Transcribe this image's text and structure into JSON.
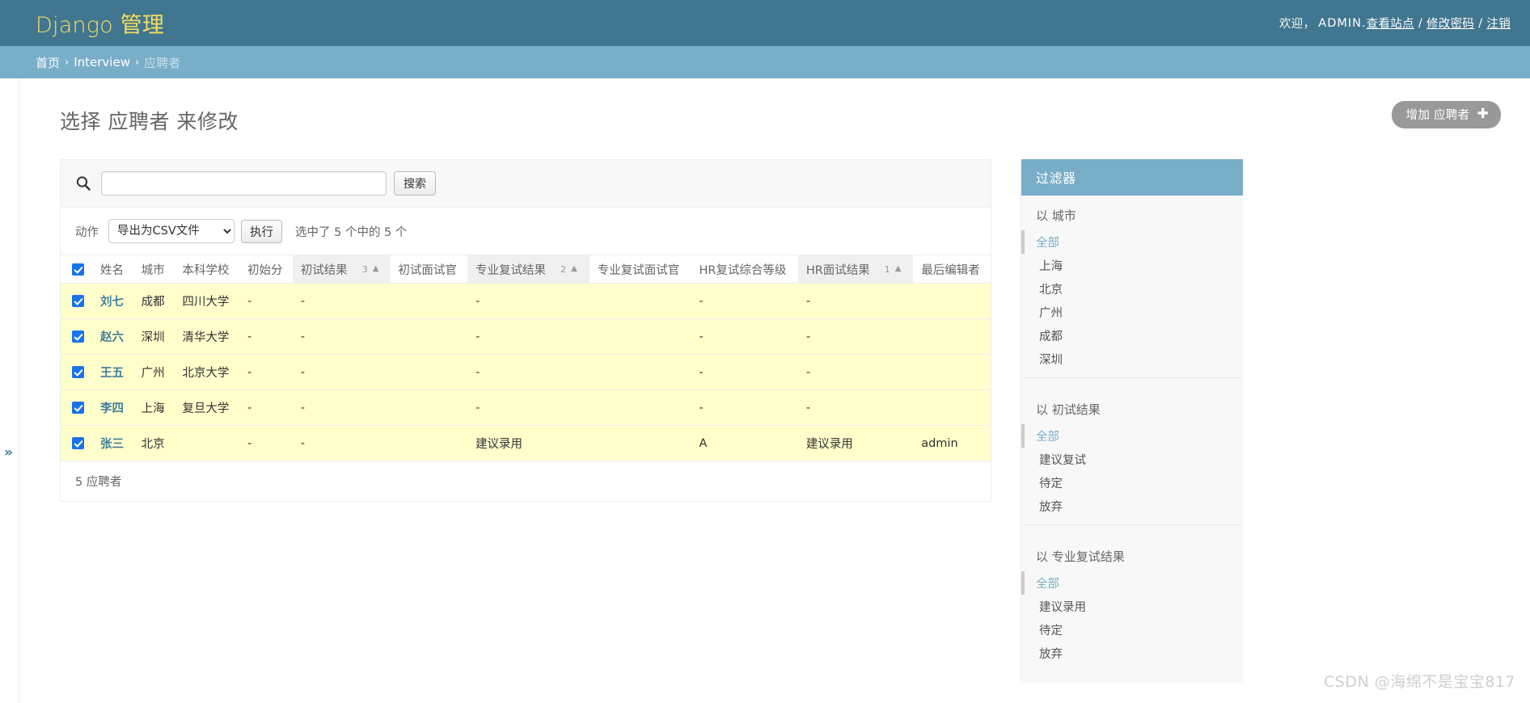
{
  "header": {
    "branding_title": "Django 管理",
    "welcome": "欢迎，",
    "username": "ADMIN.",
    "links": [
      {
        "label": "查看站点"
      },
      {
        "label": "修改密码"
      },
      {
        "label": "注销"
      }
    ],
    "separator": "/"
  },
  "breadcrumbs": {
    "items": [
      {
        "label": "首页",
        "current": false
      },
      {
        "label": "Interview",
        "current": false
      },
      {
        "label": "应聘者",
        "current": true
      }
    ],
    "separator": "›"
  },
  "page": {
    "title": "选择 应聘者 来修改",
    "add_button_label": "增加 应聘者",
    "add_button_icon": "plus-icon"
  },
  "search": {
    "icon": "search-icon",
    "value": "",
    "placeholder": "",
    "submit_label": "搜索"
  },
  "actions": {
    "label": "动作",
    "selected_action": "导出为CSV文件",
    "options": [
      "导出为CSV文件"
    ],
    "go_label": "执行",
    "counter": "选中了 5 个中的 5 个"
  },
  "table": {
    "select_all_checked": true,
    "columns": [
      {
        "label": "",
        "key": "checkbox",
        "sorted": false,
        "sort_priority": "",
        "sort_arrow": ""
      },
      {
        "label": "姓名",
        "key": "name",
        "sorted": false,
        "sort_priority": "",
        "sort_arrow": ""
      },
      {
        "label": "城市",
        "key": "city",
        "sorted": false,
        "sort_priority": "",
        "sort_arrow": ""
      },
      {
        "label": "本科学校",
        "key": "school",
        "sorted": false,
        "sort_priority": "",
        "sort_arrow": ""
      },
      {
        "label": "初始分",
        "key": "initial_score",
        "sorted": false,
        "sort_priority": "",
        "sort_arrow": ""
      },
      {
        "label": "初试结果",
        "key": "first_result",
        "sorted": true,
        "sort_priority": "3",
        "sort_arrow": "▲"
      },
      {
        "label": "初试面试官",
        "key": "first_interviewer",
        "sorted": false,
        "sort_priority": "",
        "sort_arrow": ""
      },
      {
        "label": "专业复试结果",
        "key": "second_result",
        "sorted": true,
        "sort_priority": "2",
        "sort_arrow": "▲"
      },
      {
        "label": "专业复试面试官",
        "key": "second_interviewer",
        "sorted": false,
        "sort_priority": "",
        "sort_arrow": ""
      },
      {
        "label": "HR复试综合等级",
        "key": "hr_grade",
        "sorted": false,
        "sort_priority": "",
        "sort_arrow": ""
      },
      {
        "label": "HR面试结果",
        "key": "hr_result",
        "sorted": true,
        "sort_priority": "1",
        "sort_arrow": "▲"
      },
      {
        "label": "最后编辑者",
        "key": "last_editor",
        "sorted": false,
        "sort_priority": "",
        "sort_arrow": ""
      }
    ],
    "rows": [
      {
        "checked": true,
        "name": "刘七",
        "city": "成都",
        "school": "四川大学",
        "initial_score": "-",
        "first_result": "-",
        "first_interviewer": "",
        "second_result": "-",
        "second_interviewer": "",
        "hr_grade": "-",
        "hr_result": "-",
        "last_editor": ""
      },
      {
        "checked": true,
        "name": "赵六",
        "city": "深圳",
        "school": "清华大学",
        "initial_score": "-",
        "first_result": "-",
        "first_interviewer": "",
        "second_result": "-",
        "second_interviewer": "",
        "hr_grade": "-",
        "hr_result": "-",
        "last_editor": ""
      },
      {
        "checked": true,
        "name": "王五",
        "city": "广州",
        "school": "北京大学",
        "initial_score": "-",
        "first_result": "-",
        "first_interviewer": "",
        "second_result": "-",
        "second_interviewer": "",
        "hr_grade": "-",
        "hr_result": "-",
        "last_editor": ""
      },
      {
        "checked": true,
        "name": "李四",
        "city": "上海",
        "school": "复旦大学",
        "initial_score": "-",
        "first_result": "-",
        "first_interviewer": "",
        "second_result": "-",
        "second_interviewer": "",
        "hr_grade": "-",
        "hr_result": "-",
        "last_editor": ""
      },
      {
        "checked": true,
        "name": "张三",
        "city": "北京",
        "school": "",
        "initial_score": "-",
        "first_result": "-",
        "first_interviewer": "",
        "second_result": "建议录用",
        "second_interviewer": "",
        "hr_grade": "A",
        "hr_result": "建议录用",
        "last_editor": "admin"
      }
    ]
  },
  "paginator": {
    "count_text": "5 应聘者"
  },
  "filter": {
    "header": "过滤器",
    "groups": [
      {
        "title": "以 城市",
        "choices": [
          {
            "label": "全部",
            "selected": true
          },
          {
            "label": "上海",
            "selected": false
          },
          {
            "label": "北京",
            "selected": false
          },
          {
            "label": "广州",
            "selected": false
          },
          {
            "label": "成都",
            "selected": false
          },
          {
            "label": "深圳",
            "selected": false
          }
        ]
      },
      {
        "title": "以 初试结果",
        "choices": [
          {
            "label": "全部",
            "selected": true
          },
          {
            "label": "建议复试",
            "selected": false
          },
          {
            "label": "待定",
            "selected": false
          },
          {
            "label": "放弃",
            "selected": false
          }
        ]
      },
      {
        "title": "以 专业复试结果",
        "choices": [
          {
            "label": "全部",
            "selected": true
          },
          {
            "label": "建议录用",
            "selected": false
          },
          {
            "label": "待定",
            "selected": false
          },
          {
            "label": "放弃",
            "selected": false
          }
        ]
      }
    ]
  },
  "sidebar_toggle": {
    "icon": "chevron-double-right-icon",
    "glyph": "»"
  },
  "watermark": {
    "text": "CSDN @海绵不是宝宝817"
  },
  "colors": {
    "header_bg": "#417690",
    "breadcrumb_bg": "#79aec8",
    "brand_text": "#f5dd5d",
    "link": "#447e9b",
    "row_highlight": "#ffffcc",
    "add_button_bg": "#999999"
  }
}
